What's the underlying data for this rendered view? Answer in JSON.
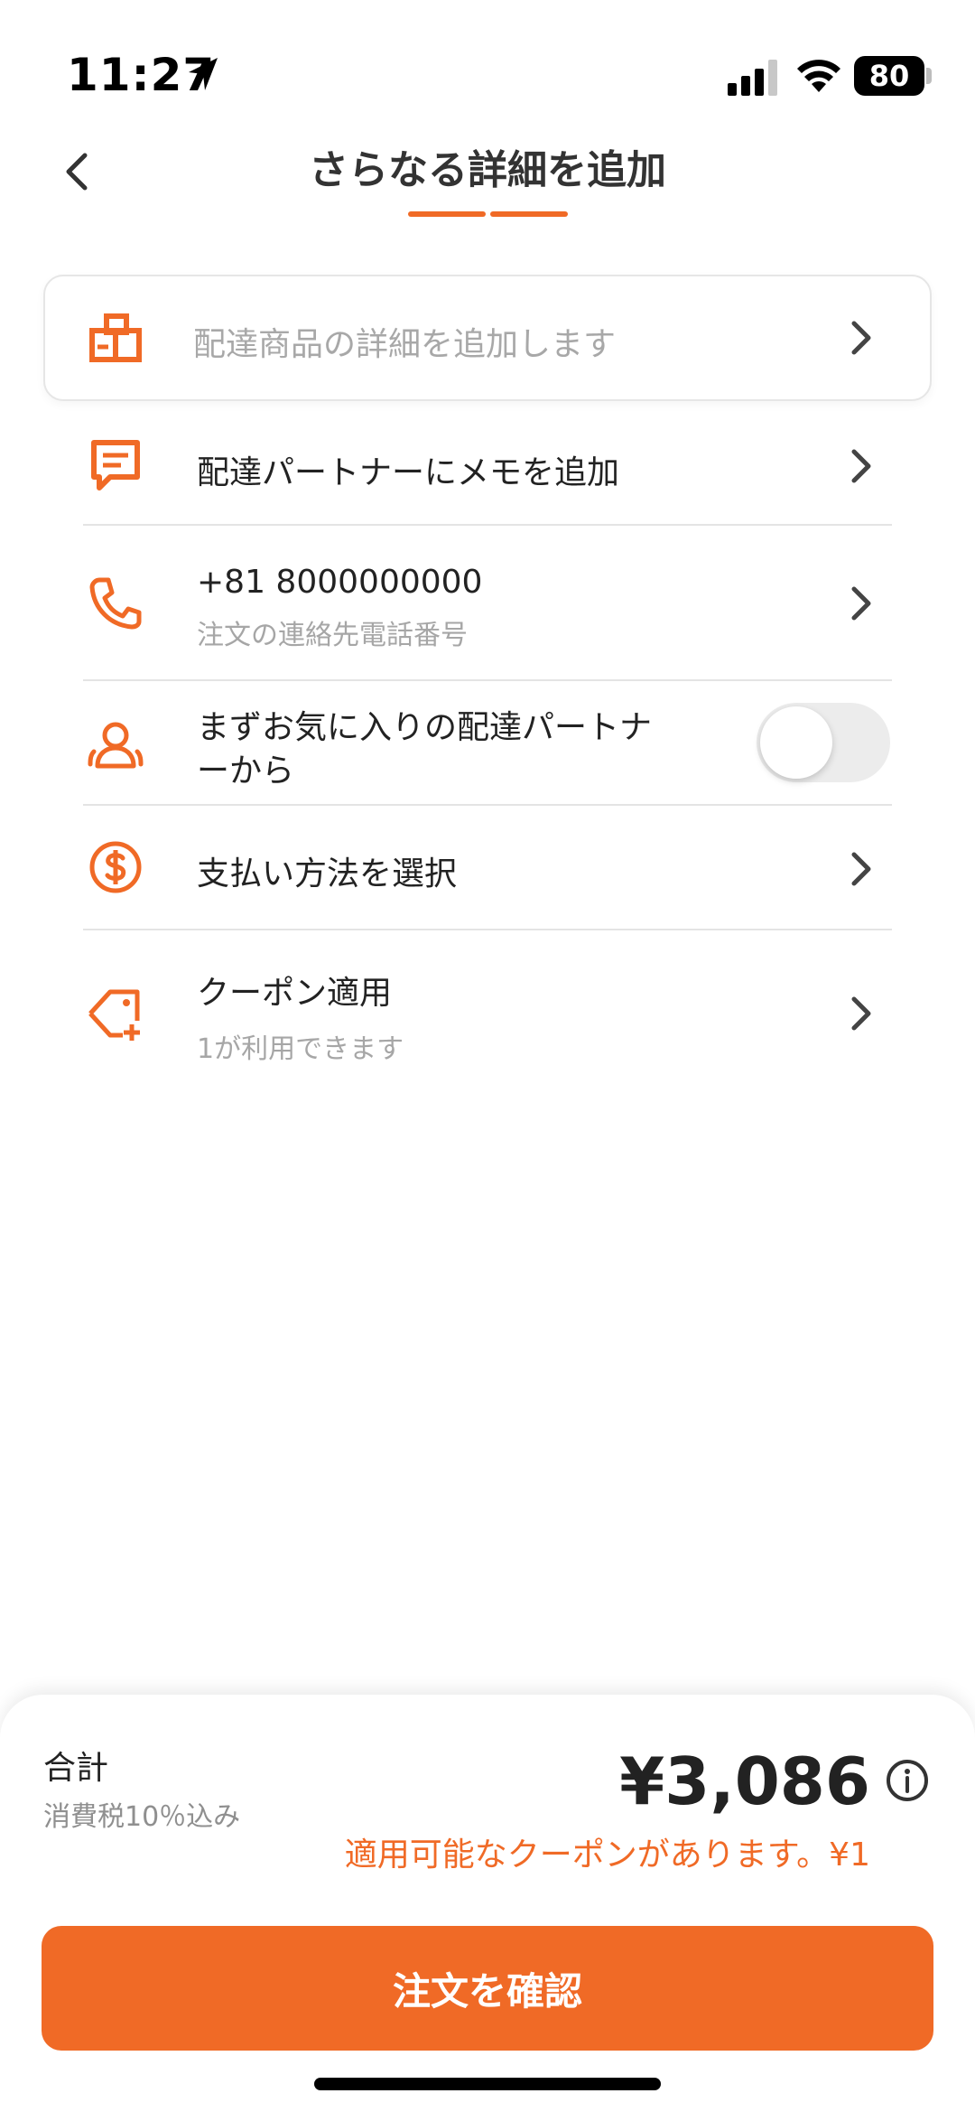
{
  "status_bar": {
    "time": "11:27",
    "battery": "80"
  },
  "header": {
    "title": "さらなる詳細を追加",
    "progress_steps": 2
  },
  "rows": {
    "item_details": {
      "label": "配達商品の詳細を追加します",
      "icon": "package-icon"
    },
    "memo": {
      "label": "配達パートナーにメモを追加",
      "icon": "chat-icon"
    },
    "phone": {
      "label": "+81 8000000000",
      "sub": "注文の連絡先電話番号",
      "icon": "phone-icon"
    },
    "favorite": {
      "label_line1": "まずお気に入りの配達パートナ",
      "label_line2": "ーから",
      "icon": "partners-icon",
      "toggle_on": false
    },
    "payment": {
      "label": "支払い方法を選択",
      "icon": "dollar-icon"
    },
    "coupon": {
      "label": "クーポン適用",
      "sub": "1が利用できます",
      "icon": "coupon-tag-icon"
    }
  },
  "summary": {
    "total_label": "合計",
    "tax_note": "消費税10％込み",
    "total_amount": "¥3,086",
    "coupon_note": "適用可能なクーポンがあります。¥1"
  },
  "actions": {
    "confirm_label": "注文を確認"
  },
  "colors": {
    "accent": "#f06a26",
    "text": "#222222",
    "muted": "#a6a6a6"
  }
}
